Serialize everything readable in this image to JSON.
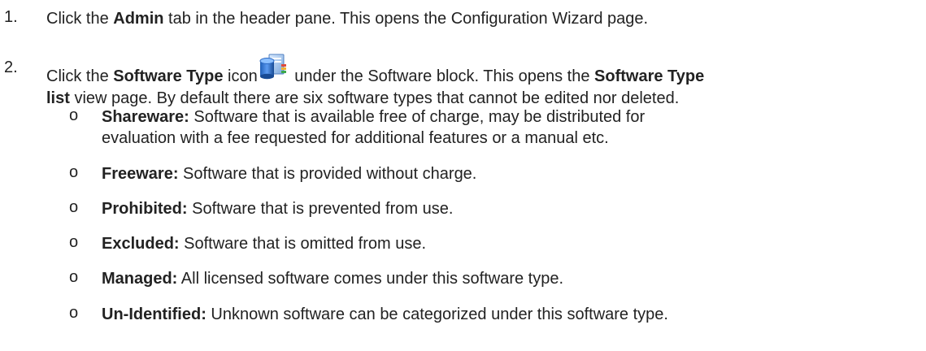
{
  "steps": [
    {
      "number": "1.",
      "pre": "Click the ",
      "bold": "Admin",
      "post": " tab in the header pane. This opens the Configuration Wizard page."
    },
    {
      "number": "2.",
      "pre": "Click the ",
      "bold1": "Software Type",
      "mid1": " icon",
      "icon": "software-type-icon",
      "mid2": " under the Software block. This opens the ",
      "bold2": "Software Type",
      "bold3": "list",
      "post": " view page. By default there are six software types that cannot be edited nor deleted."
    }
  ],
  "bullet_marker": "o",
  "software_types": [
    {
      "term": "Shareware:",
      "desc_line1": " Software that is available free of charge, may be distributed for",
      "desc_line2": "evaluation with a fee requested for additional features or a manual etc."
    },
    {
      "term": "Freeware:",
      "desc": " Software that is provided without charge."
    },
    {
      "term": "Prohibited:",
      "desc": " Software that is prevented from use."
    },
    {
      "term": "Excluded:",
      "desc": " Software that is omitted from use."
    },
    {
      "term": "Managed:",
      "desc": " All licensed software comes under this software type."
    },
    {
      "term": "Un-Identified:",
      "desc": " Unknown software can be categorized under this software type."
    }
  ]
}
